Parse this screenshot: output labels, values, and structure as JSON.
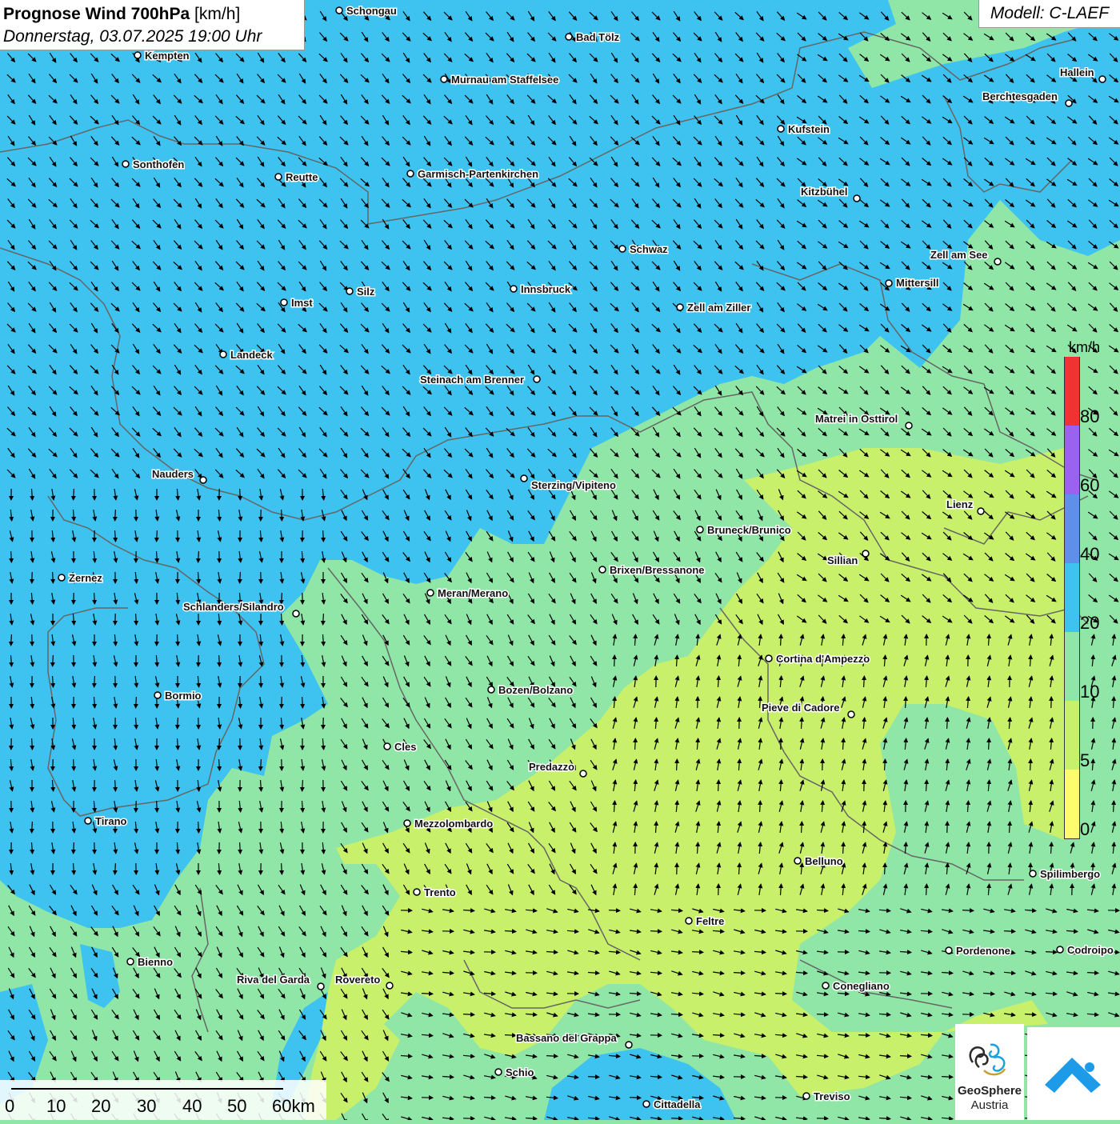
{
  "header": {
    "title_bold": "Prognose Wind 700hPa",
    "title_unit": "[km/h]",
    "datetime": "Donnerstag, 03.07.2025 19:00 Uhr",
    "model": "Modell: C-LAEF"
  },
  "legend": {
    "unit": "km/h",
    "classes": [
      {
        "label": "0",
        "color": "#fffb6e"
      },
      {
        "label": "5",
        "color": "#c8f06a"
      },
      {
        "label": "10",
        "color": "#8fe6a6"
      },
      {
        "label": "20",
        "color": "#3ec2f0"
      },
      {
        "label": "40",
        "color": "#5f8fe8"
      },
      {
        "label": "60",
        "color": "#9a62ee"
      },
      {
        "label": "80",
        "color": "#f03232"
      }
    ]
  },
  "scalebar": {
    "labels": [
      "0",
      "10",
      "20",
      "30",
      "40",
      "50",
      "60km"
    ]
  },
  "branding": {
    "logo_text_line1": "GeoSphere",
    "logo_text_line2": "Austria",
    "logo_icon": "geosphere-logo-icon",
    "app_icon": "wind-app-icon"
  },
  "colors": {
    "water": "#3cbcf0",
    "wind_10_20": "#8fe6a6",
    "wind_5_10": "#c8f06a",
    "wind_20_40": "#3ec2f0",
    "border": "#666666"
  },
  "cities": [
    {
      "name": "Schongau"
    },
    {
      "name": "Bad Tölz"
    },
    {
      "name": "Kempten"
    },
    {
      "name": "Murnau am Staffelsee"
    },
    {
      "name": "Hallein"
    },
    {
      "name": "Berchtesgaden"
    },
    {
      "name": "Kufstein"
    },
    {
      "name": "Sonthofen"
    },
    {
      "name": "Reutte"
    },
    {
      "name": "Garmisch-Partenkirchen"
    },
    {
      "name": "Kitzbühel"
    },
    {
      "name": "Schwaz"
    },
    {
      "name": "Zell am See"
    },
    {
      "name": "Mittersill"
    },
    {
      "name": "Silz"
    },
    {
      "name": "Innsbruck"
    },
    {
      "name": "Imst"
    },
    {
      "name": "Zell am Ziller"
    },
    {
      "name": "Landeck"
    },
    {
      "name": "Steinach am Brenner"
    },
    {
      "name": "Matrei in Osttirol"
    },
    {
      "name": "Nauders"
    },
    {
      "name": "Sterzing/Vipiteno"
    },
    {
      "name": "Lienz"
    },
    {
      "name": "Bruneck/Brunico"
    },
    {
      "name": "Sillian"
    },
    {
      "name": "Zernez"
    },
    {
      "name": "Brixen/Bressanone"
    },
    {
      "name": "Meran/Merano"
    },
    {
      "name": "Schlanders/Silandro"
    },
    {
      "name": "Cortina d'Ampezzo"
    },
    {
      "name": "Bozen/Bolzano"
    },
    {
      "name": "Bormio"
    },
    {
      "name": "Pieve di Cadore"
    },
    {
      "name": "Cles"
    },
    {
      "name": "Predazzo"
    },
    {
      "name": "Tirano"
    },
    {
      "name": "Mezzolombardo"
    },
    {
      "name": "Belluno"
    },
    {
      "name": "Spilimbergo"
    },
    {
      "name": "Trento"
    },
    {
      "name": "Feltre"
    },
    {
      "name": "Bienno"
    },
    {
      "name": "Pordenone"
    },
    {
      "name": "Codroipo"
    },
    {
      "name": "Riva del Garda"
    },
    {
      "name": "Rovereto"
    },
    {
      "name": "Conegliano"
    },
    {
      "name": "Bassano del Grappa"
    },
    {
      "name": "Schio"
    },
    {
      "name": "Treviso"
    },
    {
      "name": "Cittadella"
    }
  ]
}
